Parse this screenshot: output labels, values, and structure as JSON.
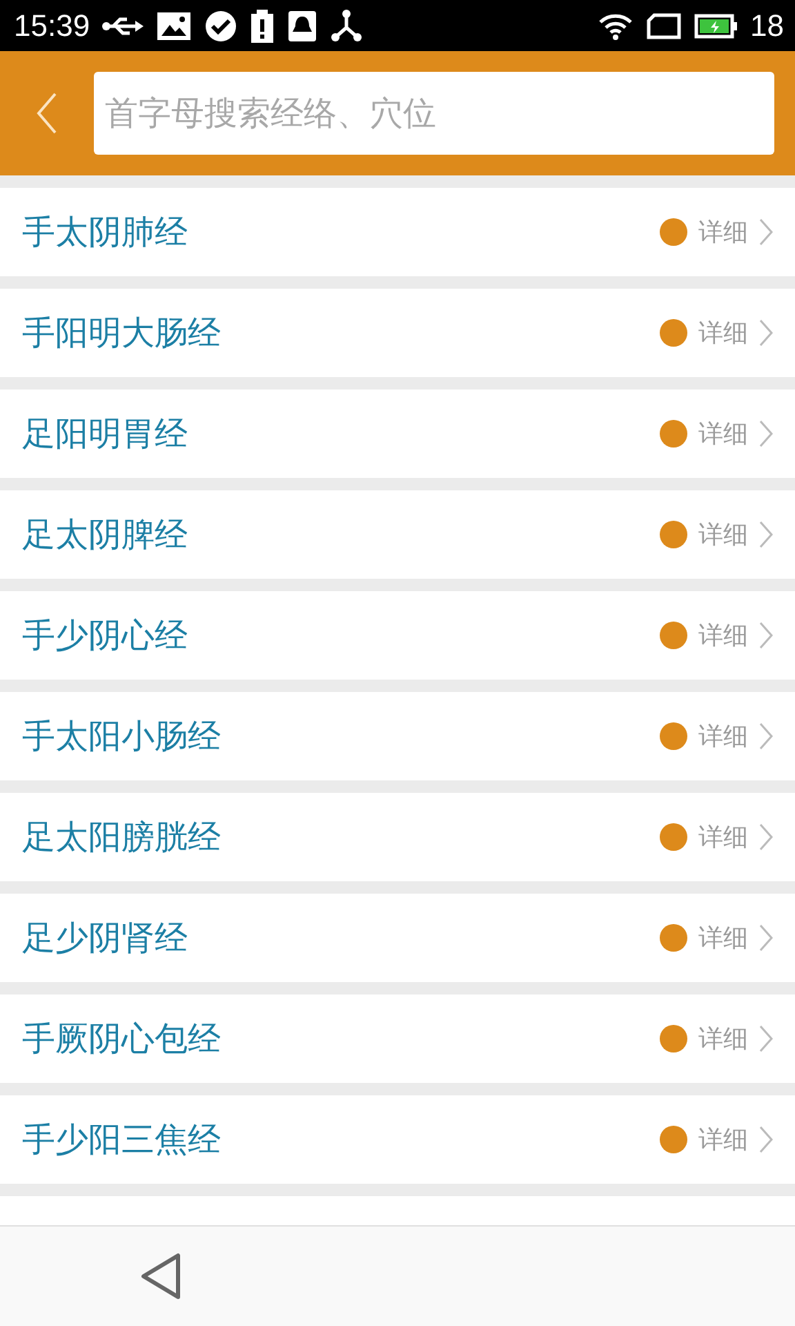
{
  "status_bar": {
    "time": "15:39",
    "battery": "18"
  },
  "search": {
    "placeholder": "首字母搜索经络、穴位"
  },
  "meridians": [
    {
      "name": "手太阴肺经",
      "detail": "详细"
    },
    {
      "name": "手阳明大肠经",
      "detail": "详细"
    },
    {
      "name": "足阳明胃经",
      "detail": "详细"
    },
    {
      "name": "足太阴脾经",
      "detail": "详细"
    },
    {
      "name": "手少阴心经",
      "detail": "详细"
    },
    {
      "name": "手太阳小肠经",
      "detail": "详细"
    },
    {
      "name": "足太阳膀胱经",
      "detail": "详细"
    },
    {
      "name": "足少阴肾经",
      "detail": "详细"
    },
    {
      "name": "手厥阴心包经",
      "detail": "详细"
    },
    {
      "name": "手少阳三焦经",
      "detail": "详细"
    }
  ]
}
